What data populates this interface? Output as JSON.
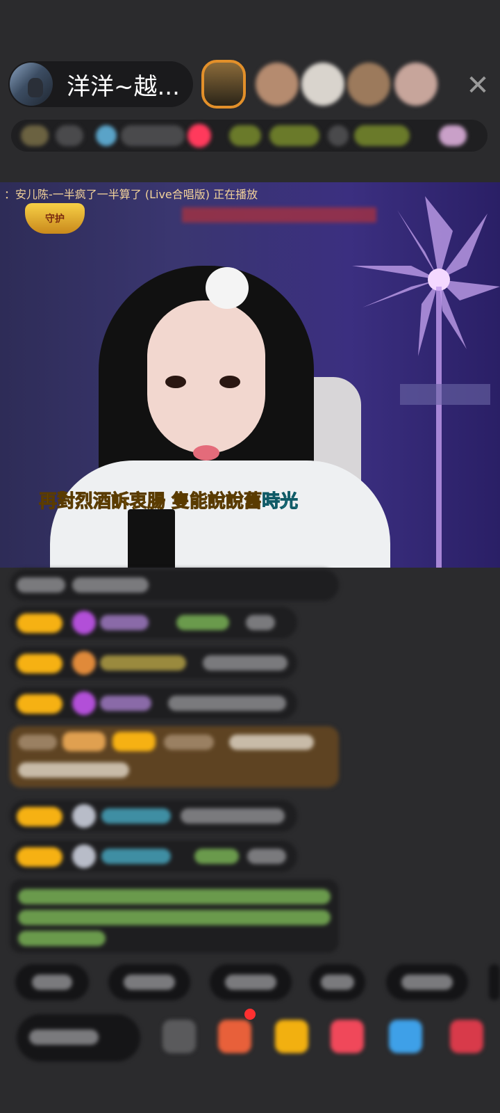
{
  "header": {
    "host_name": "洋洋~越...",
    "close_glyph": "✕"
  },
  "video": {
    "now_playing": "：安儿陈-一半疯了一半算了 (Live合唱版) 正在播放",
    "badge_text": "守护",
    "lyric_main": "再對烈酒訴衷腸  隻能說說舊",
    "lyric_tail": "時光"
  },
  "colors": {
    "background": "#2b2b2d",
    "level_badge": "#f6b113",
    "lyric_yellow": "#f7c531",
    "lyric_cyan": "#6fe6f0"
  },
  "icons": {
    "close": "close-icon",
    "gift": "gift-icon",
    "diamond": "diamond-icon"
  }
}
